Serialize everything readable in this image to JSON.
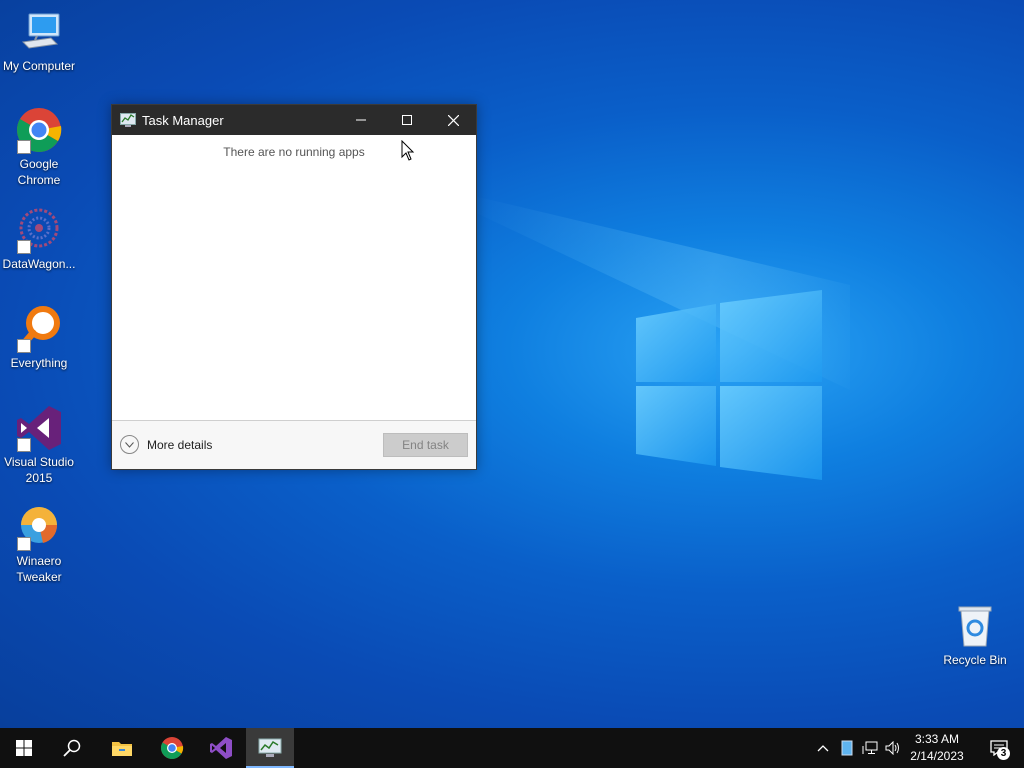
{
  "desktop": {
    "icons": [
      {
        "label": "My Computer",
        "icon": "computer-icon"
      },
      {
        "label": "Google Chrome",
        "icon": "chrome-icon"
      },
      {
        "label": "DataWagon...",
        "icon": "datawagon-icon"
      },
      {
        "label": "Everything",
        "icon": "everything-search-icon"
      },
      {
        "label": "Visual Studio 2015",
        "icon": "visual-studio-icon"
      },
      {
        "label": "Winaero Tweaker",
        "icon": "winaero-tweaker-icon"
      },
      {
        "label": "Recycle Bin",
        "icon": "recycle-bin-icon"
      }
    ]
  },
  "window": {
    "title": "Task Manager",
    "empty_message": "There are no running apps",
    "more_details_label": "More details",
    "end_task_label": "End task"
  },
  "taskbar": {
    "apps": [
      "start-icon",
      "search-icon",
      "file-explorer-icon",
      "chrome-icon",
      "visual-studio-icon",
      "task-manager-icon"
    ],
    "clock_time": "3:33 AM",
    "clock_date": "2/14/2023",
    "notification_count": "3"
  },
  "colors": {
    "accent": "#0a5fc9",
    "taskbar": "#101010",
    "titlebar": "#2b2b2b"
  }
}
